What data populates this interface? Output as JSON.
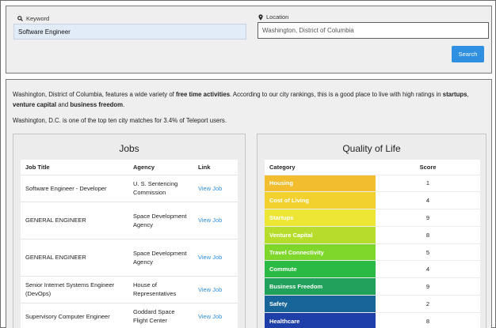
{
  "search": {
    "keyword_label": "Keyword",
    "keyword_value": "Software Engineer",
    "location_label": "Location",
    "location_value": "Washington, District of Columbia",
    "search_button": "Search"
  },
  "intro": {
    "p1_a": "Washington, District of Columbia, features a wide variety of ",
    "p1_b": "free time activities",
    "p1_c": ". According to our city rankings, this is a good place to live with high ratings in ",
    "p1_d": "startups",
    "p1_e": ", ",
    "p1_f": "venture capital",
    "p1_g": " and ",
    "p1_h": "business freedom",
    "p1_i": ".",
    "p2": "Washington, D.C. is one of the top ten city matches for 3.4% of Teleport users."
  },
  "jobs": {
    "title": "Jobs",
    "headers": [
      "Job Title",
      "Agency",
      "Link"
    ],
    "rows": [
      {
        "title": "Software Engineer - Developer",
        "agency": "U. S. Sentencing Commission",
        "link": "View Job"
      },
      {
        "title": "GENERAL ENGINEER",
        "agency": "Space Development Agency",
        "link": "View Job"
      },
      {
        "title": "GENERAL ENGINEER",
        "agency": "Space Development Agency",
        "link": "View Job"
      },
      {
        "title": "Senior Internet Systems Engineer (DevOps)",
        "agency": "House of Representatives",
        "link": "View Job"
      },
      {
        "title": "Supervisory Computer Engineer",
        "agency": "Goddard Space Flight Center",
        "link": "View Job"
      }
    ]
  },
  "qol": {
    "title": "Quality of Life",
    "headers": [
      "Category",
      "Score"
    ],
    "rows": [
      {
        "category": "Housing",
        "score": "1",
        "color": "#f2bd2f"
      },
      {
        "category": "Cost of Living",
        "score": "4",
        "color": "#f2d12e"
      },
      {
        "category": "Startups",
        "score": "9",
        "color": "#ede634"
      },
      {
        "category": "Venture Capital",
        "score": "8",
        "color": "#b6dd2b"
      },
      {
        "category": "Travel Connectivity",
        "score": "5",
        "color": "#7fd72c"
      },
      {
        "category": "Commute",
        "score": "4",
        "color": "#2bba44"
      },
      {
        "category": "Business Freedom",
        "score": "9",
        "color": "#21a25a"
      },
      {
        "category": "Safety",
        "score": "2",
        "color": "#18659a"
      },
      {
        "category": "Healthcare",
        "score": "8",
        "color": "#1f3fa8"
      }
    ]
  }
}
